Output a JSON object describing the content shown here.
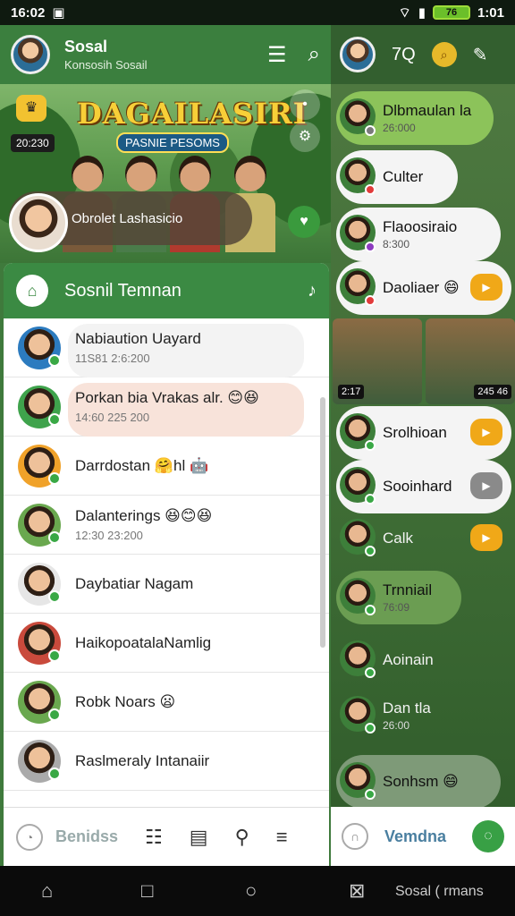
{
  "status": {
    "left": "16:02",
    "time": "1:01",
    "battery": "76"
  },
  "left": {
    "header": {
      "title": "Sosal",
      "subtitle": "Konsosih Sosail"
    },
    "banner": {
      "title": "DAGAILASIRI",
      "subtitle": "PASNIE PESOMS",
      "tag": "20:230",
      "group_label": "Obrolet Lashasicio"
    },
    "friends": {
      "title": "Sosnil Temnan",
      "rows": [
        {
          "name": "Nabiaution Uayard",
          "time": "11S81 2:6:200"
        },
        {
          "name": "Porkan bia Vrakas alr. 😊😆",
          "time": "14:60 225 200"
        },
        {
          "name": "Darrdostan 🤗hl 🤖",
          "time": ""
        },
        {
          "name": "Dalanterings 😆😊😆",
          "time": "12:30 23:200"
        },
        {
          "name": "Daybatiar Nagam",
          "time": ""
        },
        {
          "name": "HaikopoatalaNamlig",
          "time": ""
        },
        {
          "name": "Robk Noars 😦",
          "time": ""
        },
        {
          "name": "Raslmeraly Intanaiir",
          "time": ""
        }
      ]
    },
    "nav": {
      "label": "Benidss"
    }
  },
  "right": {
    "header": {
      "title": "7Q"
    },
    "chats": [
      {
        "name": "Dlbmaulan la",
        "time": "26:000"
      },
      {
        "name": "Culter",
        "time": ""
      },
      {
        "name": "Flaoosiraio",
        "time": "8:300"
      },
      {
        "name": "Daoliaer 😄",
        "time": ""
      },
      {
        "name": "Srolhioan",
        "time": ""
      },
      {
        "name": "Sooinhard",
        "time": ""
      },
      {
        "name": "Calk",
        "time": ""
      },
      {
        "name": "Trnniail",
        "time": "76:09"
      },
      {
        "name": "Aoinain",
        "time": ""
      },
      {
        "name": "Dan tla",
        "time": "26:00"
      },
      {
        "name": "Sonhsm 😄",
        "time": ""
      }
    ],
    "video": {
      "tag_left": "2:17",
      "tag_right": "245 46"
    },
    "nav": {
      "label": "Vemdna"
    }
  },
  "sysnav": {
    "right_label": "Sosal ( rmans"
  },
  "colors": {
    "header_green": "#3b7f3e",
    "accent_green": "#3b8a43",
    "orange": "#f0a818",
    "banner_gold": "#f7cf38"
  }
}
